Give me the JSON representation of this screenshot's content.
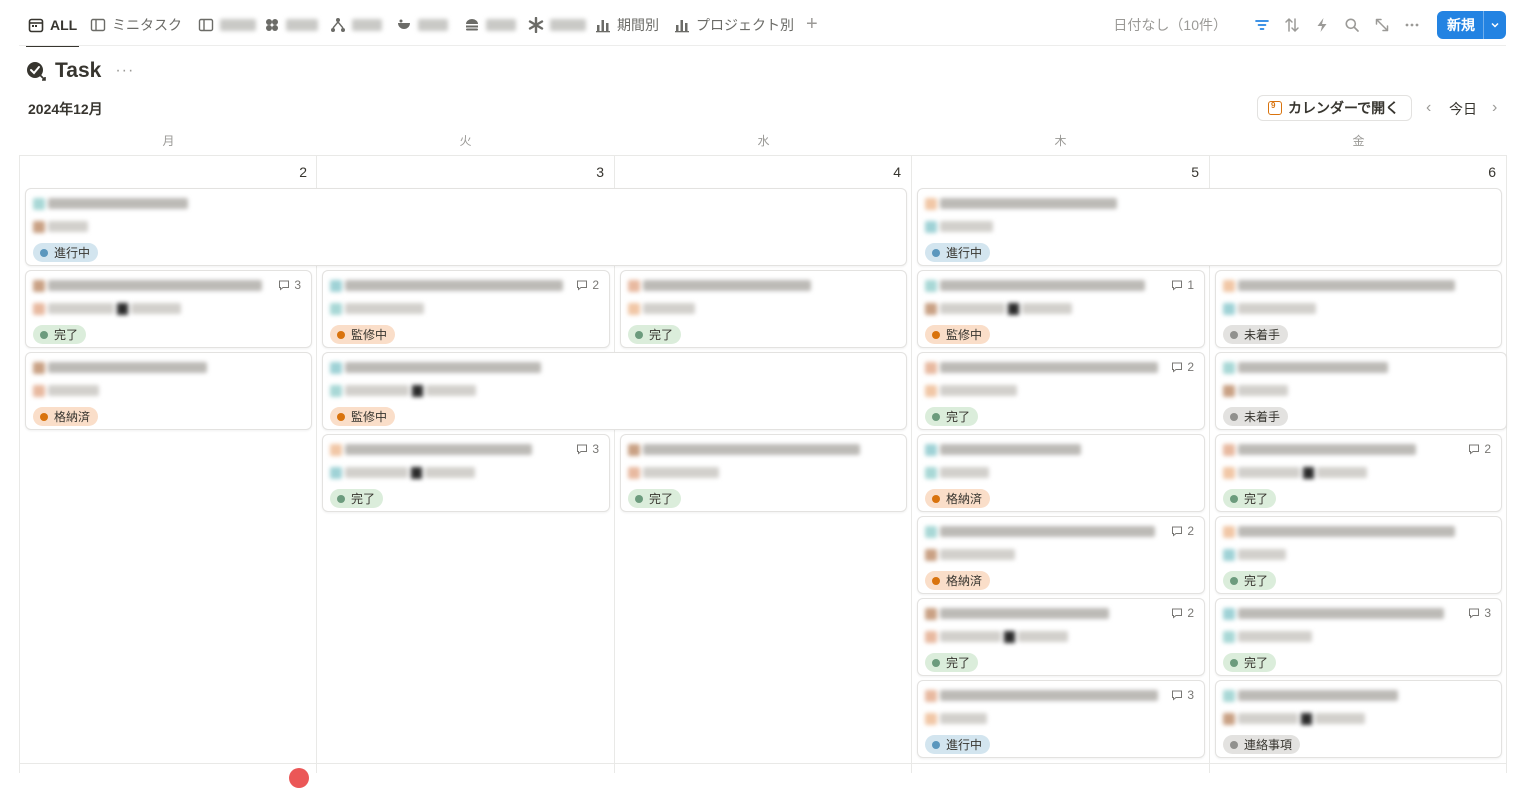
{
  "tabs": {
    "all": "ALL",
    "mini_task": "ミニタスク",
    "by_period": "期間別",
    "by_project": "プロジェクト別",
    "add": "+"
  },
  "toolbar": {
    "no_date": "日付なし（10件）",
    "new_label": "新規"
  },
  "page": {
    "title": "Task",
    "more": "···"
  },
  "calendar": {
    "month": "2024年12月",
    "open_calendar": "カレンダーで開く",
    "today": "今日",
    "weekdays": [
      "月",
      "火",
      "水",
      "木",
      "金"
    ],
    "days": [
      "2",
      "3",
      "4",
      "5",
      "6"
    ]
  },
  "cards": [
    {
      "status": "進行中",
      "color": "blue"
    },
    {
      "status": "進行中",
      "color": "blue"
    },
    {
      "status": "完了",
      "color": "green",
      "comments": "3"
    },
    {
      "status": "監修中",
      "color": "orange",
      "comments": "2"
    },
    {
      "status": "完了",
      "color": "green"
    },
    {
      "status": "監修中",
      "color": "orange",
      "comments": "1"
    },
    {
      "status": "未着手",
      "color": "gray"
    },
    {
      "status": "格納済",
      "color": "orange"
    },
    {
      "status": "監修中",
      "color": "orange"
    },
    {
      "status": "完了",
      "color": "green",
      "comments": "2"
    },
    {
      "status": "未着手",
      "color": "gray"
    },
    {
      "status": "完了",
      "color": "green",
      "comments": "3"
    },
    {
      "status": "完了",
      "color": "green"
    },
    {
      "status": "格納済",
      "color": "orange"
    },
    {
      "status": "完了",
      "color": "green",
      "comments": "2"
    },
    {
      "status": "格納済",
      "color": "orange",
      "comments": "2"
    },
    {
      "status": "完了",
      "color": "green"
    },
    {
      "status": "完了",
      "color": "green",
      "comments": "2"
    },
    {
      "status": "完了",
      "color": "green",
      "comments": "3"
    },
    {
      "status": "進行中",
      "color": "blue",
      "comments": "3"
    },
    {
      "status": "連絡事項",
      "color": "gray"
    }
  ]
}
